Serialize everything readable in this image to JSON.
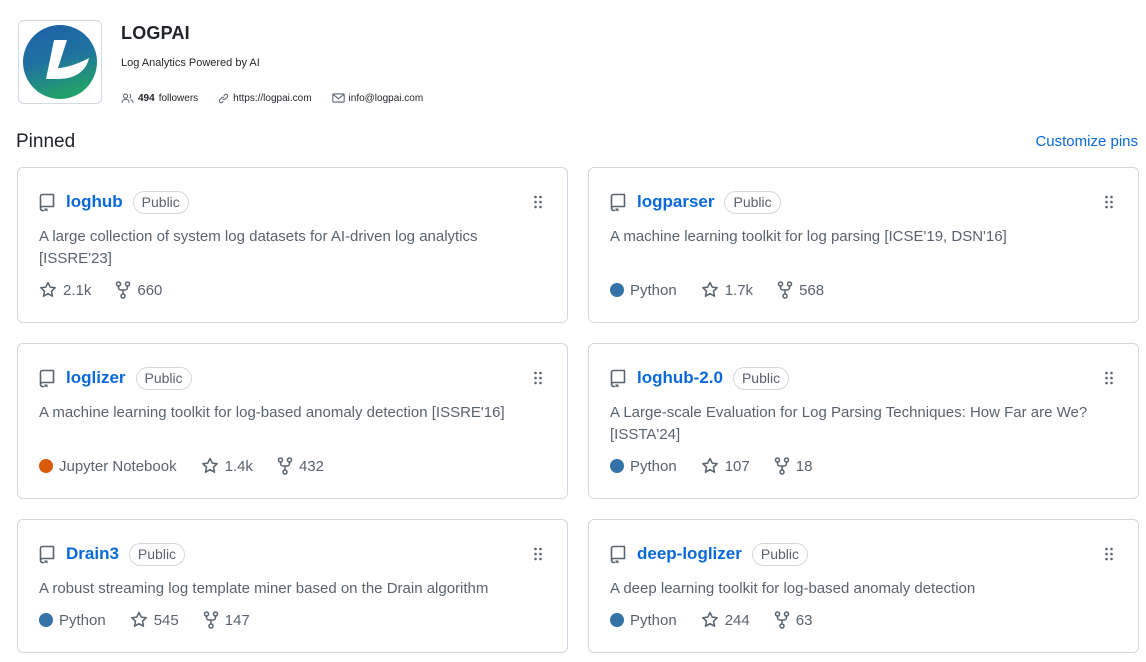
{
  "org": {
    "name": "LOGPAI",
    "description": "Log Analytics Powered by AI",
    "followers_count": "494",
    "followers_label": "followers",
    "website": "https://logpai.com",
    "email": "info@logpai.com",
    "brand_colors": {
      "blue": "#1f5fa8",
      "green": "#22a06b"
    }
  },
  "pinned": {
    "title": "Pinned",
    "customize_label": "Customize pins",
    "repos": [
      {
        "name": "loghub",
        "visibility": "Public",
        "description": "A large collection of system log datasets for AI-driven log analytics [ISSRE'23]",
        "language": "",
        "language_color": "",
        "stars": "2.1k",
        "forks": "660"
      },
      {
        "name": "logparser",
        "visibility": "Public",
        "description": "A machine learning toolkit for log parsing [ICSE'19, DSN'16]",
        "language": "Python",
        "language_color": "#3572A5",
        "stars": "1.7k",
        "forks": "568"
      },
      {
        "name": "loglizer",
        "visibility": "Public",
        "description": "A machine learning toolkit for log-based anomaly detection [ISSRE'16]",
        "language": "Jupyter Notebook",
        "language_color": "#DA5B0B",
        "stars": "1.4k",
        "forks": "432"
      },
      {
        "name": "loghub-2.0",
        "visibility": "Public",
        "description": "A Large-scale Evaluation for Log Parsing Techniques: How Far are We? [ISSTA'24]",
        "language": "Python",
        "language_color": "#3572A5",
        "stars": "107",
        "forks": "18"
      },
      {
        "name": "Drain3",
        "visibility": "Public",
        "description": "A robust streaming log template miner based on the Drain algorithm",
        "language": "Python",
        "language_color": "#3572A5",
        "stars": "545",
        "forks": "147"
      },
      {
        "name": "deep-loglizer",
        "visibility": "Public",
        "description": "A deep learning toolkit for log-based anomaly detection",
        "language": "Python",
        "language_color": "#3572A5",
        "stars": "244",
        "forks": "63"
      }
    ]
  },
  "icons": {
    "repo": "repo-icon",
    "star": "star-icon",
    "fork": "fork-icon",
    "drag": "drag-handle-icon",
    "people": "people-icon",
    "link": "link-icon",
    "mail": "mail-icon"
  }
}
